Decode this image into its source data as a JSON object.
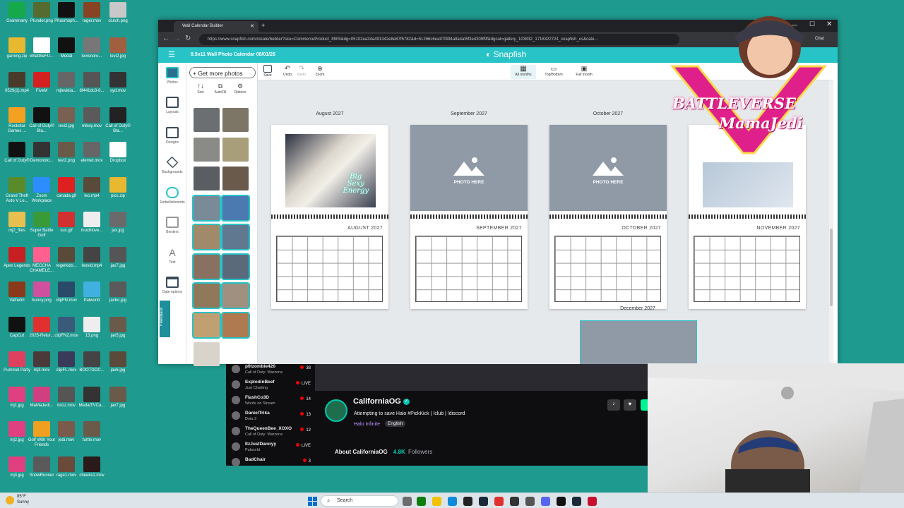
{
  "desktop": {
    "icons": [
      {
        "label": "Grammarly",
        "color": "#15a94a"
      },
      {
        "label": "Plunder.png",
        "color": "#556b2f"
      },
      {
        "label": "Phasmoph...",
        "color": "#111111"
      },
      {
        "label": "rager.mov",
        "color": "#884422"
      },
      {
        "label": "clutch.png",
        "color": "#c8c8c8"
      },
      {
        "label": "gaming.zip",
        "color": "#e8b830"
      },
      {
        "label": "whattheFU...",
        "color": "#ffffff"
      },
      {
        "label": "Medal",
        "color": "#111111"
      },
      {
        "label": "levisnore...",
        "color": "#777777"
      },
      {
        "label": "levi2.jpg",
        "color": "#a06040"
      },
      {
        "label": "0529(1).mp4",
        "color": "#4a3a2a"
      },
      {
        "label": "FiveM",
        "color": "#d42020"
      },
      {
        "label": "mjlevidia...",
        "color": "#666666"
      },
      {
        "label": "8f441dc3-8...",
        "color": "#555555"
      },
      {
        "label": "syd.mov",
        "color": "#333333"
      },
      {
        "label": "Rockstar Games ...",
        "color": "#f4a020"
      },
      {
        "label": "Call of Duty® Bla...",
        "color": "#111111"
      },
      {
        "label": "levi2.jpg",
        "color": "#7a6050"
      },
      {
        "label": "mikey.mov",
        "color": "#5a5a5a"
      },
      {
        "label": "Call of Duty® Bla...",
        "color": "#222222"
      },
      {
        "label": "Call of Duty®",
        "color": "#111111"
      },
      {
        "label": "Demonolo...",
        "color": "#333333"
      },
      {
        "label": "levi2.png",
        "color": "#6a5a4a"
      },
      {
        "label": "elemet.mov",
        "color": "#666666"
      },
      {
        "label": "Dropbox",
        "color": "#ffffff"
      },
      {
        "label": "Grand Theft Auto V Le...",
        "color": "#5a8a2a"
      },
      {
        "label": "Zoom Workplace",
        "color": "#2d8cff"
      },
      {
        "label": "canada.gif",
        "color": "#e02020"
      },
      {
        "label": "leo.mp4",
        "color": "#5a4a3a"
      },
      {
        "label": "pics.zip",
        "color": "#e8b830"
      },
      {
        "label": "mj2_files",
        "color": "#e8c050"
      },
      {
        "label": "Super Battle Golf",
        "color": "#3a9a3a"
      },
      {
        "label": "sus.gif",
        "color": "#d03030"
      },
      {
        "label": "muchlove...",
        "color": "#eeeeee"
      },
      {
        "label": "jax.jpg",
        "color": "#6a6a6a"
      },
      {
        "label": "Apex Legends",
        "color": "#c82020"
      },
      {
        "label": "MECCHA CHAMELE...",
        "color": "#ff6090"
      },
      {
        "label": "regerkids...",
        "color": "#5a4a3a"
      },
      {
        "label": "leovid.mp4",
        "color": "#444444"
      },
      {
        "label": "jax7.jpg",
        "color": "#555555"
      },
      {
        "label": "Valheim",
        "color": "#8a3a1a"
      },
      {
        "label": "bunny.png",
        "color": "#d050a0"
      },
      {
        "label": "clipFN.mov",
        "color": "#2a4a6a"
      },
      {
        "label": "Palworld",
        "color": "#40b0e0"
      },
      {
        "label": "jaxbo.jpg",
        "color": "#5a5a5a"
      },
      {
        "label": "CapCut",
        "color": "#111111"
      },
      {
        "label": "2025-Retur...",
        "color": "#e03030"
      },
      {
        "label": "clipFN2.mov",
        "color": "#3a5a7a"
      },
      {
        "label": "13.png",
        "color": "#eeeeee"
      },
      {
        "label": "jax5.jpg",
        "color": "#6a5a4a"
      },
      {
        "label": "Pummel Party",
        "color": "#e04060"
      },
      {
        "label": "mj3.mov",
        "color": "#4a3a3a"
      },
      {
        "label": "clipFL.mov",
        "color": "#3a3a5a"
      },
      {
        "label": "BOOTDOC...",
        "color": "#444444"
      },
      {
        "label": "jax6.jpg",
        "color": "#5a4a3a"
      },
      {
        "label": "mj1.jpg",
        "color": "#e04080"
      },
      {
        "label": "MaMaJedi...",
        "color": "#d04080"
      },
      {
        "label": "bozz.mov",
        "color": "#555555"
      },
      {
        "label": "MedalTVCa...",
        "color": "#333333"
      },
      {
        "label": "jax7.jpg",
        "color": "#6a5a4a"
      },
      {
        "label": "mj2.jpg",
        "color": "#e04080"
      },
      {
        "label": "Golf With Your Friends",
        "color": "#f0a020"
      },
      {
        "label": "jedi.mov",
        "color": "#7a5a4a"
      },
      {
        "label": "turtle.mov",
        "color": "#6a5a4a"
      },
      {
        "label": "",
        "color": "#1f9a8f"
      },
      {
        "label": "mj3.jpg",
        "color": "#e04080"
      },
      {
        "label": "SnowRunner",
        "color": "#5a5a5a"
      },
      {
        "label": "rage1.mov",
        "color": "#6a4a3a"
      },
      {
        "label": "cheeks1.mov",
        "color": "#2a1a1a"
      },
      {
        "label": "",
        "color": "#1f9a8f"
      }
    ]
  },
  "taskbar": {
    "temp": "85°F",
    "condition": "Sunny",
    "search_placeholder": "Search"
  },
  "browser": {
    "tab_title": "Wall Calendar Builder",
    "url": "https://www.snapfish.com/create/builder?sku=CommerceProduct_8905&dg=05102ea34a491342e8e87f6782&d=51266c6ea97f494a8a4af6f3e4309f9f&dgcat=gallery_103832_1716322724_snapfish_us&cate...",
    "ext_label": "Chat"
  },
  "app": {
    "title": "8.5x11 Wall Photo Calendar 08/01/26",
    "logo": "Snapfish",
    "rail": [
      "Photos",
      "Layouts",
      "Designs",
      "Backgrounds",
      "Embellishments",
      "Borders",
      "Text",
      "Date options"
    ],
    "feedback": "Feedback",
    "more_photos": "+ Get more photos",
    "panel_tools": [
      "Sort",
      "AutoFill",
      "Options"
    ],
    "toolbar": [
      "Save",
      "Undo",
      "Redo",
      "Zoom"
    ],
    "views": [
      "All months",
      "Top/Bottom",
      "Full month"
    ],
    "months": [
      {
        "label": "August 2027",
        "header": "AUGUST 2027",
        "placeholder": ""
      },
      {
        "label": "September 2027",
        "header": "SEPTEMBER 2027",
        "placeholder": "PHOTO HERE"
      },
      {
        "label": "October 2027",
        "header": "OCTOBER 2027",
        "placeholder": "PHOTO HERE"
      },
      {
        "label": "",
        "header": "NOVEMBER 2027",
        "placeholder": ""
      }
    ],
    "next_month_label": "December 2027",
    "photo_caption": [
      "Big",
      "Sexy",
      "Energy"
    ]
  },
  "stream": {
    "following": [
      {
        "name": "p0tzombie420",
        "game": "Call of Duty: Warzone",
        "count": "38"
      },
      {
        "name": "ExplodinBeef",
        "game": "Just Chatting",
        "count": "LIVE"
      },
      {
        "name": "FlashCo3D",
        "game": "Words on Stream",
        "count": "14"
      },
      {
        "name": "DanielTrika",
        "game": "Dota 2",
        "count": "13"
      },
      {
        "name": "TheQueenBee_XOXO",
        "game": "Call of Duty: Warzone",
        "count": "12"
      },
      {
        "name": "ItzJustDannyy",
        "game": "Palworld",
        "count": "LIVE"
      },
      {
        "name": "BadChair",
        "game": "",
        "count": "3"
      }
    ],
    "channel_name": "CaliforniaOG",
    "stream_title": "Attempting to save Halo #PickKick | !club | !discord",
    "category": "Halo Infinite",
    "language": "English",
    "about": "About CaliforniaOG",
    "followers": "4.8K",
    "followers_label": "Followers"
  },
  "overlay": {
    "brand_line1": "BATTLEVERSE",
    "brand_line2": "MamaJedi"
  },
  "colors": {
    "accent": "#28c3c7",
    "desktop": "#1f9a8f",
    "twitch_live": "#eb0400",
    "verified": "#00c8af"
  }
}
